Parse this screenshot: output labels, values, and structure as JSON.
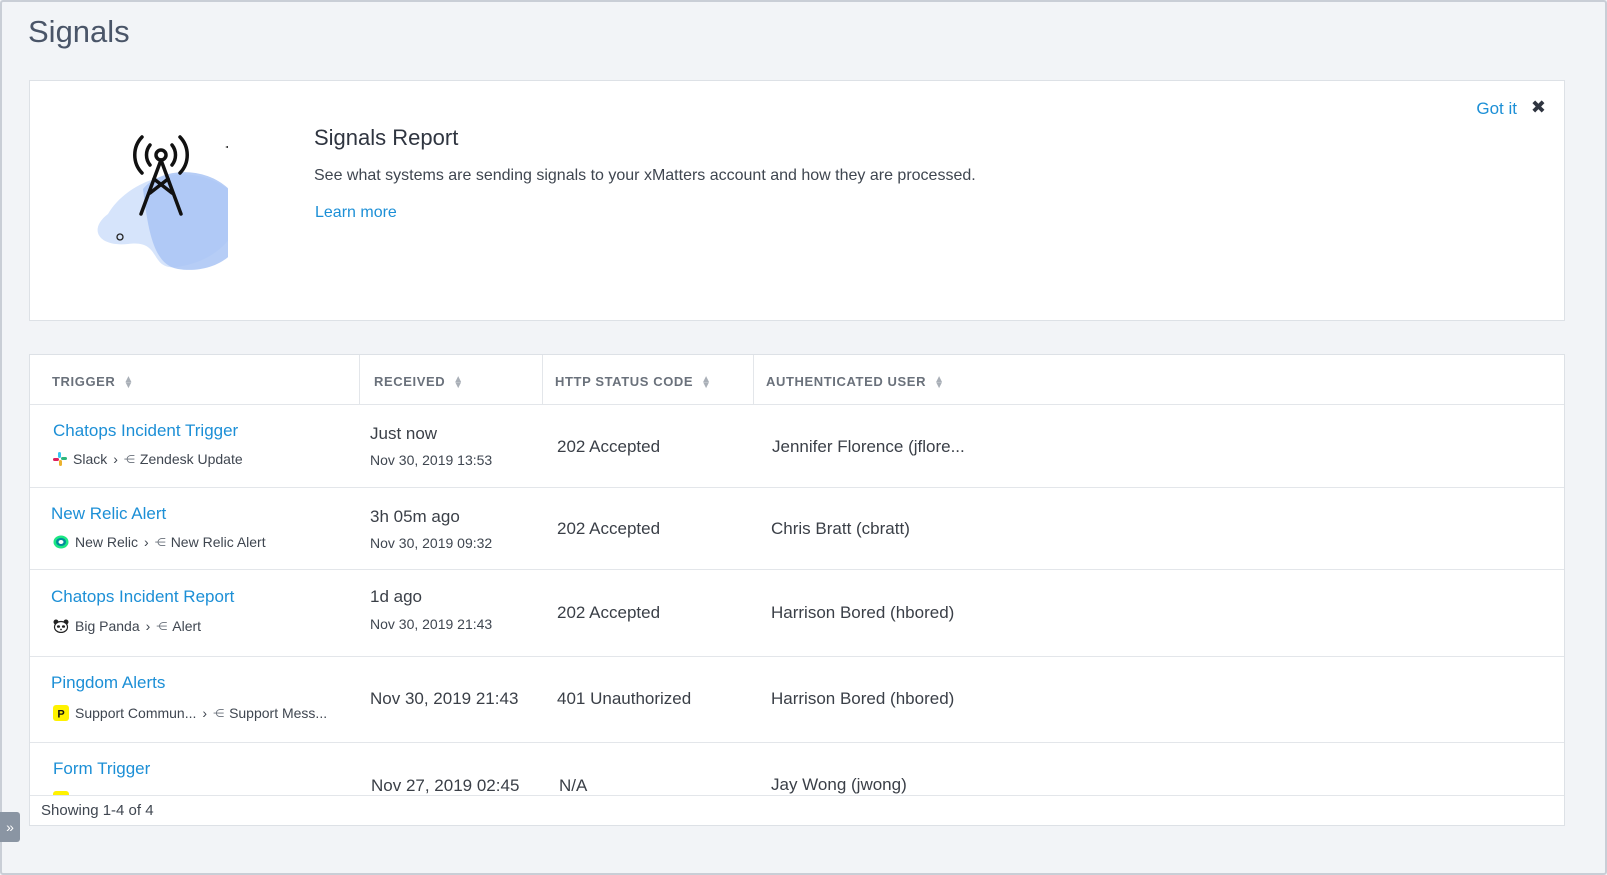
{
  "page": {
    "title": "Signals"
  },
  "banner": {
    "title": "Signals Report",
    "description": "See what systems are sending signals to your xMatters account and how they are processed.",
    "learn_more": "Learn more",
    "got_it": "Got it",
    "close": "✖"
  },
  "table": {
    "columns": [
      "TRIGGER",
      "RECEIVED",
      "HTTP STATUS CODE",
      "AUTHENTICATED USER"
    ],
    "rows": [
      {
        "trigger": "Chatops Incident Trigger",
        "source": "Slack",
        "target": "Zendesk Update",
        "source_icon": "slack-icon",
        "received": "Just now",
        "received_date": "Nov 30, 2019  13:53",
        "status": "202 Accepted",
        "user": "Jennifer Florence (jflore..."
      },
      {
        "trigger": "New Relic Alert",
        "source": "New Relic",
        "target": "New Relic Alert",
        "source_icon": "new-relic-icon",
        "received": "3h 05m ago",
        "received_date": "Nov 30, 2019 09:32",
        "status": "202 Accepted",
        "user": "Chris Bratt (cbratt)"
      },
      {
        "trigger": "Chatops Incident Report",
        "source": "Big Panda",
        "target": "Alert",
        "source_icon": "big-panda-icon",
        "received": "1d ago",
        "received_date": "Nov 30, 2019 21:43",
        "status": "202 Accepted",
        "user": "Harrison Bored (hbored)"
      },
      {
        "trigger": "Pingdom Alerts",
        "source": "Support Commun...",
        "target": "Support Mess...",
        "source_icon": "pingdom-icon",
        "received": "Nov 30, 2019 21:43",
        "status": "401 Unauthorized",
        "user": "Harrison Bored (hbored)"
      },
      {
        "trigger": "Form Trigger",
        "received": "Nov 27, 2019 02:45",
        "status": "N/A",
        "user": "Jay Wong (jwong)"
      }
    ],
    "footer": "Showing 1-4 of 4"
  },
  "colors": {
    "link": "#1c8fd6",
    "accent_blob": "#a9c4f5"
  }
}
